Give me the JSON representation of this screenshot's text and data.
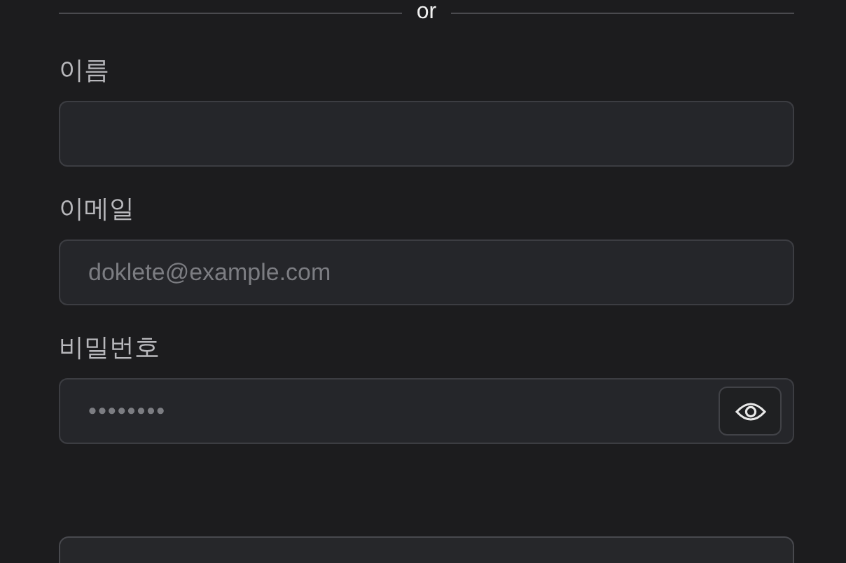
{
  "divider": {
    "label": "or"
  },
  "fields": [
    {
      "kind": "text",
      "label": "이름"
    },
    {
      "kind": "email",
      "label": "이메일",
      "placeholder": "doklete@example.com"
    },
    {
      "kind": "password",
      "label": "비밀번호",
      "placeholder": "••••••••"
    }
  ]
}
